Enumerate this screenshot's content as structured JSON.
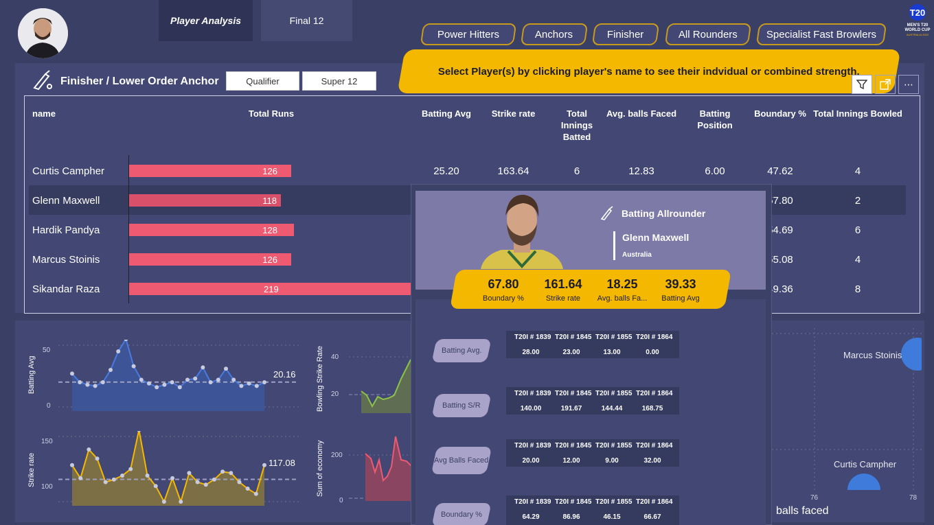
{
  "tabs": [
    "Player Analysis",
    "Final 12"
  ],
  "nav": [
    "Power Hitters",
    "Anchors",
    "Finisher",
    "All Rounders",
    "Specialist Fast Browlers"
  ],
  "banner": "Select Player(s) by clicking player's name to see their indvidual or combined strength.",
  "logo_text": "T20 MEN'S T20 WORLD CUP AUSTRALIA 2022",
  "panel_title": "Finisher / Lower Order Anchor",
  "slicers": [
    "Qualifier",
    "Super 12"
  ],
  "table": {
    "headers": [
      "name",
      "Total Runs",
      "Batting Avg",
      "Strike rate",
      "Total Innings Batted",
      "Avg. balls Faced",
      "Batting Position",
      "Boundary %",
      "Total Innings Bowled"
    ],
    "rows": [
      {
        "name": "Curtis Campher",
        "runs": "126",
        "avg": "25.20",
        "sr": "163.64",
        "inn": "6",
        "balls": "12.83",
        "pos": "6.00",
        "bnd": "47.62",
        "bowled": "4"
      },
      {
        "name": "Glenn Maxwell",
        "runs": "118",
        "avg": "",
        "sr": "",
        "inn": "",
        "balls": "",
        "pos": "",
        "bnd": "57.80",
        "bowled": "2"
      },
      {
        "name": "Hardik Pandya",
        "runs": "128",
        "avg": "",
        "sr": "",
        "inn": "",
        "balls": "",
        "pos": "",
        "bnd": "54.69",
        "bowled": "6"
      },
      {
        "name": "Marcus Stoinis",
        "runs": "126",
        "avg": "",
        "sr": "",
        "inn": "",
        "balls": "",
        "pos": "",
        "bnd": "55.08",
        "bowled": "4"
      },
      {
        "name": "Sikandar Raza",
        "runs": "219",
        "avg": "",
        "sr": "",
        "inn": "",
        "balls": "",
        "pos": "",
        "bnd": "49.36",
        "bowled": "8"
      }
    ],
    "runs_values": [
      126,
      118,
      128,
      126,
      219
    ]
  },
  "charts": {
    "batting_avg": {
      "ylabel": "Batting Avg",
      "ticks": [
        "50",
        "0"
      ],
      "ref_label": "20.16",
      "values": [
        27,
        20,
        18,
        17,
        20,
        30,
        45,
        55,
        33,
        22,
        19,
        16,
        18,
        20,
        16,
        22,
        23,
        32,
        20,
        22,
        31,
        22,
        17,
        19,
        17,
        20
      ]
    },
    "strike_rate": {
      "ylabel": "Strike rate",
      "ticks": [
        "150",
        "100"
      ],
      "ref_label": "117.08",
      "values": [
        128,
        118,
        140,
        133,
        115,
        117,
        120,
        125,
        155,
        120,
        112,
        100,
        118,
        100,
        122,
        115,
        113,
        117,
        123,
        122,
        115,
        110,
        106,
        128
      ]
    },
    "bowling_sr": {
      "ylabel": "Bowling Strike Rate",
      "ticks": [
        "40",
        "20"
      ]
    },
    "economy": {
      "ylabel": "Sum of economy",
      "ticks": [
        "200",
        "0"
      ]
    },
    "scatter": {
      "labels": [
        "Marcus Stoinis",
        "Curtis Campher"
      ],
      "xticks": [
        "76",
        "78"
      ],
      "xlabel": "balls faced"
    }
  },
  "popup": {
    "role": "Batting Allrounder",
    "player": "Glenn Maxwell",
    "country": "Australia",
    "stats": [
      {
        "value": "67.80",
        "label": "Boundary %"
      },
      {
        "value": "161.64",
        "label": "Strike rate"
      },
      {
        "value": "18.25",
        "label": "Avg. balls Fa..."
      },
      {
        "value": "39.33",
        "label": "Batting Avg"
      }
    ],
    "matches": [
      "T20I # 1839",
      "T20I # 1845",
      "T20I # 1855",
      "T20I # 1864"
    ],
    "metrics": [
      {
        "label": "Batting Avg.",
        "values": [
          "28.00",
          "23.00",
          "13.00",
          "0.00"
        ]
      },
      {
        "label": "Batting S/R",
        "values": [
          "140.00",
          "191.67",
          "144.44",
          "168.75"
        ]
      },
      {
        "label": "Avg Balls Faced",
        "values": [
          "20.00",
          "12.00",
          "9.00",
          "32.00"
        ]
      },
      {
        "label": "Boundary %",
        "values": [
          "64.29",
          "86.96",
          "46.15",
          "66.67"
        ]
      }
    ]
  },
  "colors": {
    "bar": "#ee5a72",
    "accent": "#f5b800",
    "blue": "#4a7be0",
    "gold": "#f5b800"
  }
}
